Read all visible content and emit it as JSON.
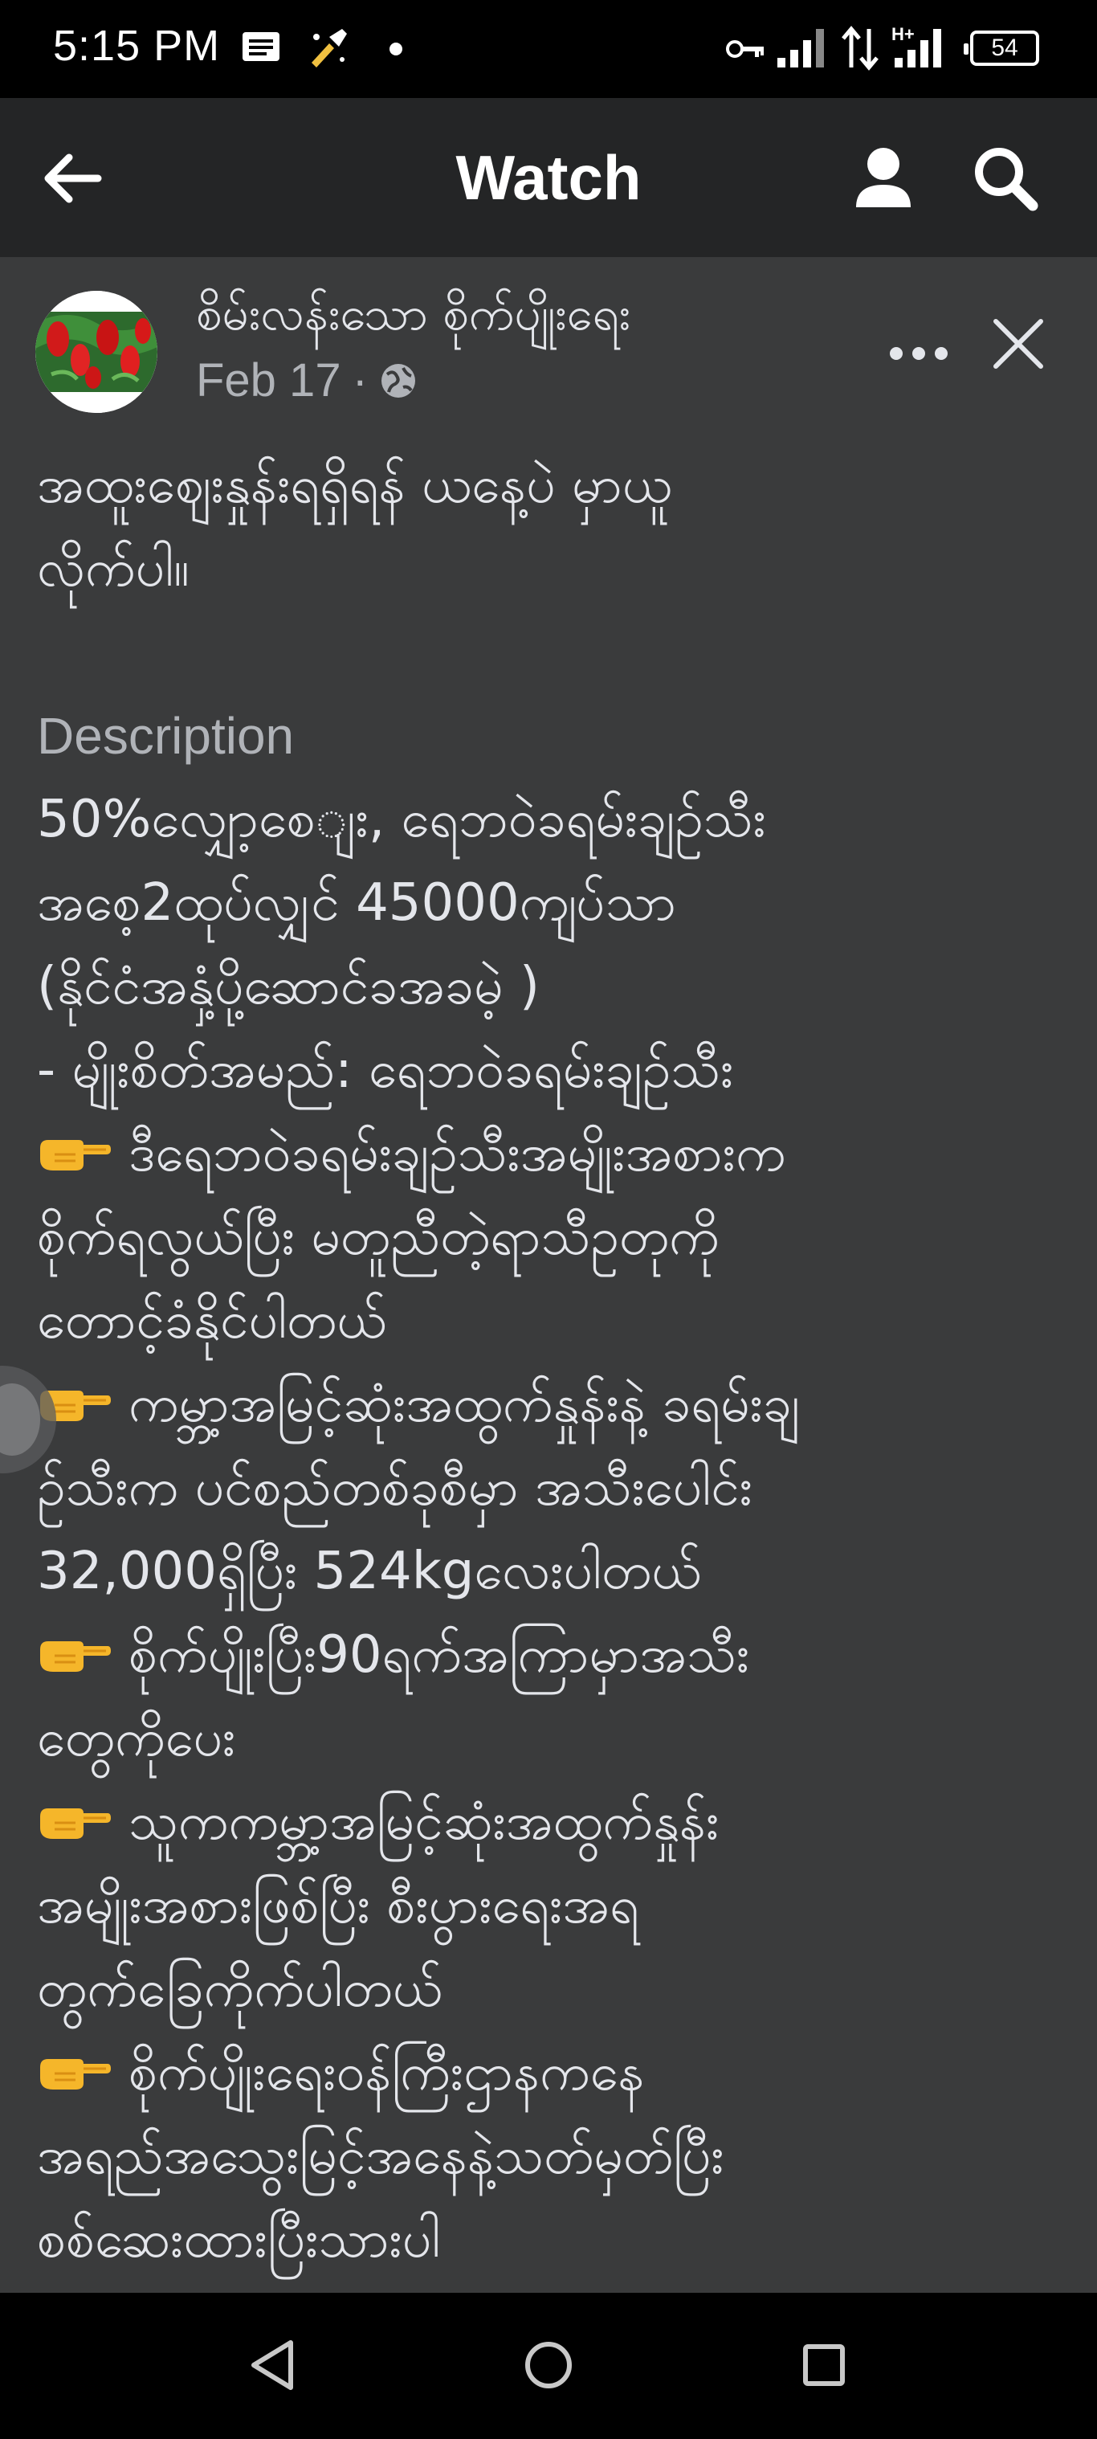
{
  "status_bar": {
    "time": "5:15 PM",
    "battery": "54",
    "icons": [
      "message-notification-icon",
      "app-notification-icon",
      "dot-icon",
      "vpn-key-icon",
      "signal-icon",
      "data-transfer-icon",
      "hplus-signal-icon",
      "battery-icon"
    ],
    "network_label": "H+"
  },
  "header": {
    "title": "Watch",
    "back_icon": "arrow-left-icon",
    "profile_icon": "person-icon",
    "search_icon": "search-icon"
  },
  "post": {
    "page_name": "စိမ်းလန်းသော စိုက်ပျိုးရေး",
    "date": "Feb 17",
    "separator": "·",
    "privacy_icon": "globe-icon",
    "body": {
      "intro_lines": [
        "အထူးဈေးနှုန်းရရှိရန် ယနေ့ပဲ မှာယူ",
        "လိုက်ပါ။"
      ],
      "description_label": "Description",
      "description_lines": [
        "50%လျှော့စေျး, ရေဘဝဲခရမ်းချဥ်သီး",
        "အစေ့2ထုပ်လျှင် 45000ကျပ်သာ",
        "(နိုင်ငံအနှံ့ပို့ဆောင်ခအခမဲ့ )",
        "- မျိုးစိတ်အမည်: ရေဘဝဲခရမ်းချဥ်သီး"
      ],
      "bullets": [
        {
          "icon": "pointing-hand-icon",
          "lines": [
            "ဒီရေဘဝဲခရမ်းချဥ်သီးအမျိုးအစားက",
            "စိုက်ရလွယ်ပြီး မတူညီတဲ့ရာသီဥတုကို",
            "တောင့်ခံနိုင်ပါတယ်"
          ]
        },
        {
          "icon": "pointing-hand-icon",
          "lines": [
            "ကမ္ဘာ့အမြင့်ဆုံးအထွက်နှုန်းနဲ့ ခရမ်းချ",
            "ဥ်သီးက ပင်စည်တစ်ခုစီမှာ အသီးပေါင်း",
            "32,000ရှိပြီး 524kgလေးပါတယ်"
          ]
        },
        {
          "icon": "pointing-hand-icon",
          "lines": [
            "စိုက်ပျိုးပြီး90ရက်အကြာမှာအသီး",
            "တွေကိုပေး"
          ]
        },
        {
          "icon": "pointing-hand-icon",
          "lines": [
            "သူကကမ္ဘာ့အမြင့်ဆုံးအထွက်နှုန်း",
            "အမျိုးအစားဖြစ်ပြီး စီးပွားရေးအရ",
            "တွက်ခြေကိုက်ပါတယ်"
          ]
        },
        {
          "icon": "pointing-hand-icon",
          "lines": [
            "စိုက်ပျိုးရေးဝန်ကြီးဌာနကနေ",
            "အရည်အသွေးမြင့်အနေနဲ့သတ်မှတ်ပြီး",
            "စစ်ဆေးထားပြီးသားပါ"
          ]
        }
      ],
      "divider": "-------------------------"
    },
    "more_icon": "more-horizontal-icon",
    "close_icon": "close-icon"
  },
  "nav_bar": {
    "back_icon": "nav-back-icon",
    "home_icon": "nav-home-icon",
    "recents_icon": "nav-recents-icon"
  },
  "colors": {
    "header_bg": "#242526",
    "post_bg": "#3a3b3c",
    "text_primary": "#e4e6eb",
    "text_secondary": "#b0b3b8"
  }
}
